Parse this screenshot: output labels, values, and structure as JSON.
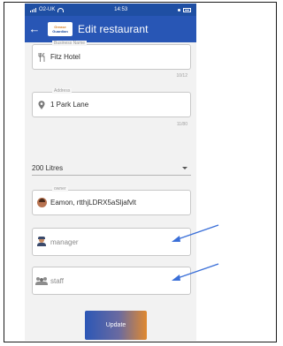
{
  "status_bar": {
    "carrier": "O2-UK",
    "time": "14:53"
  },
  "app_bar": {
    "title": "Edit restaurant",
    "logo_line1": "Grease",
    "logo_line2": "Guardian"
  },
  "form": {
    "business_name": {
      "label": "Business Name",
      "value": "Fitz Hotel",
      "counter": "10/12",
      "icon": "restaurant-icon"
    },
    "address": {
      "label": "Address",
      "value": "1 Park Lane",
      "counter": "11/80",
      "icon": "location-pin-icon"
    },
    "capacity_select": {
      "value": "200 Litres"
    },
    "owner": {
      "label": "owner",
      "value": "Eamon, rtthjLDRX5aSljafvlt",
      "icon": "owner-avatar-icon"
    },
    "manager": {
      "placeholder": "manager",
      "icon": "manager-icon"
    },
    "staff": {
      "placeholder": "staff",
      "icon": "staff-icon"
    },
    "update_button": "Update"
  },
  "colors": {
    "app_bar": "#2856b5",
    "status_bar": "#1f4fa3",
    "annotation_arrow": "#3a6fd8",
    "button_start": "#2c57b6",
    "button_end": "#e0892f"
  }
}
